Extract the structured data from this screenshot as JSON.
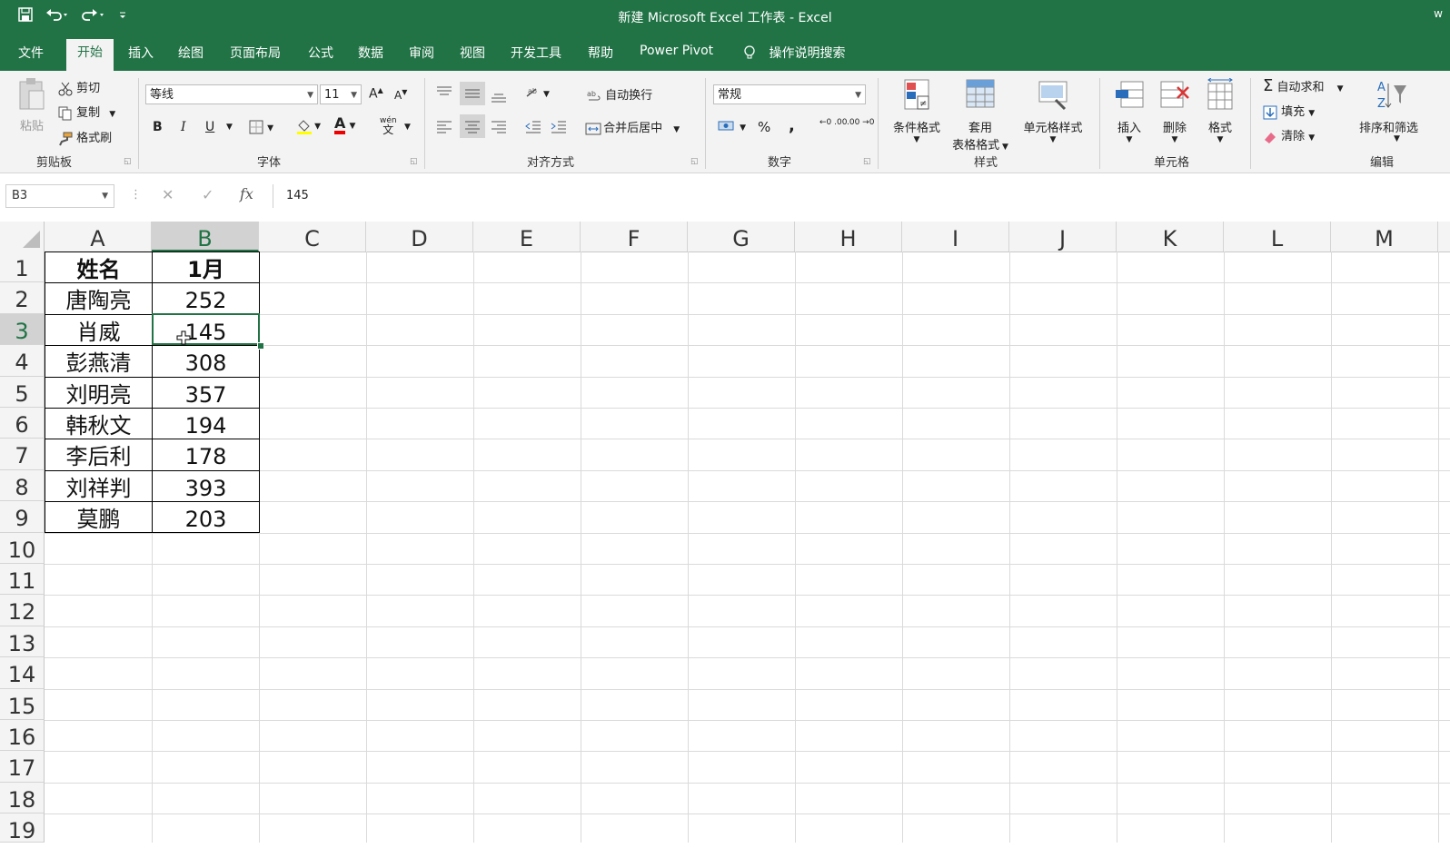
{
  "window": {
    "title": "新建 Microsoft Excel 工作表  -  Excel",
    "right_text": "w"
  },
  "quick_access": {
    "save_icon": "save-icon",
    "undo_icon": "undo-icon",
    "redo_icon": "redo-icon",
    "customize_icon": "customize-icon"
  },
  "tabs": [
    "文件",
    "开始",
    "插入",
    "绘图",
    "页面布局",
    "公式",
    "数据",
    "审阅",
    "视图",
    "开发工具",
    "帮助",
    "Power Pivot"
  ],
  "active_tab": "开始",
  "tell_me": "操作说明搜索",
  "ribbon": {
    "clipboard": {
      "paste": "粘贴",
      "cut": "剪切",
      "copy": "复制",
      "format_painter": "格式刷",
      "label": "剪贴板"
    },
    "font": {
      "font_name": "等线",
      "font_size": "11",
      "grow": "A",
      "shrink": "A",
      "bold": "B",
      "italic": "I",
      "underline": "U",
      "font_color_letter": "A",
      "phonetic_top": "wén",
      "phonetic_bottom": "文",
      "label": "字体"
    },
    "alignment": {
      "wrap_text": "自动换行",
      "merge_center": "合并后居中",
      "label": "对齐方式"
    },
    "number": {
      "format": "常规",
      "percent": "%",
      "comma": ",",
      "inc_decimal": "←0 .00",
      "dec_decimal": ".00 →0",
      "label": "数字"
    },
    "styles": {
      "conditional": "条件格式",
      "table_format_1": "套用",
      "table_format_2": "表格格式",
      "cell_styles": "单元格样式",
      "label": "样式"
    },
    "cells": {
      "insert": "插入",
      "delete": "删除",
      "format": "格式",
      "label": "单元格"
    },
    "editing": {
      "autosum": "自动求和",
      "fill": "填充",
      "clear": "清除",
      "sort_filter": "排序和筛选",
      "label": "编辑"
    }
  },
  "formula_bar": {
    "name_box": "B3",
    "fx": "fx",
    "value": "145"
  },
  "columns": [
    "A",
    "B",
    "C",
    "D",
    "E",
    "F",
    "G",
    "H",
    "I",
    "J",
    "K",
    "L",
    "M"
  ],
  "rows": [
    "1",
    "2",
    "3",
    "4",
    "5",
    "6",
    "7",
    "8",
    "9",
    "10",
    "11",
    "12",
    "13",
    "14",
    "15",
    "16",
    "17",
    "18",
    "19"
  ],
  "selected_cell": {
    "column": "B",
    "row": "3"
  },
  "sheet": {
    "header": [
      "姓名",
      "1月"
    ],
    "data": [
      [
        "唐陶亮",
        "252"
      ],
      [
        "肖威",
        "145"
      ],
      [
        "彭燕清",
        "308"
      ],
      [
        "刘明亮",
        "357"
      ],
      [
        "韩秋文",
        "194"
      ],
      [
        "李后利",
        "178"
      ],
      [
        "刘祥判",
        "393"
      ],
      [
        "莫鹏",
        "203"
      ]
    ]
  },
  "colors": {
    "accent": "#217346"
  }
}
